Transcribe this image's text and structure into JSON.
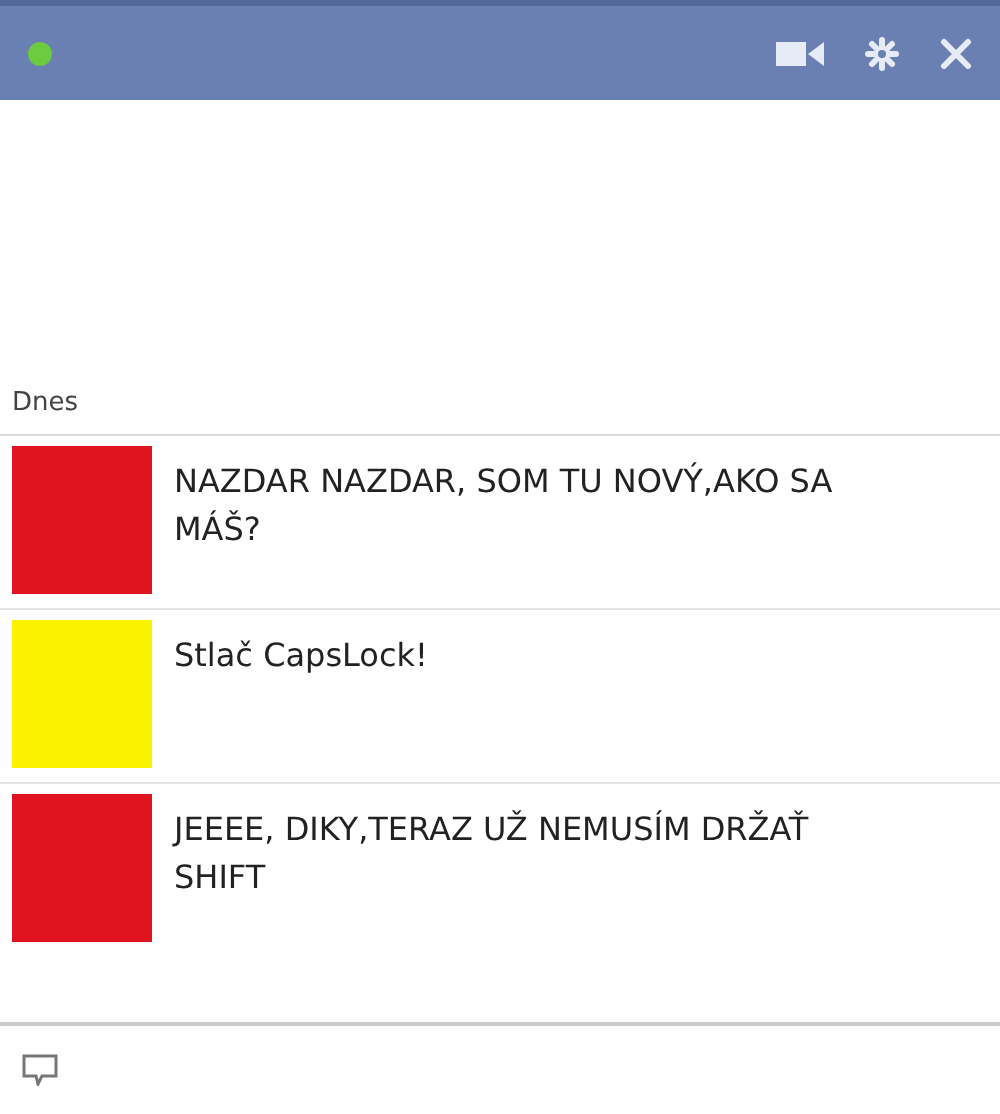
{
  "header": {
    "online": true
  },
  "date_label": "Dnes",
  "messages": [
    {
      "text": "NAZDAR NAZDAR, SOM TU NOVÝ,AKO SA MÁŠ?",
      "color": "#e0141e"
    },
    {
      "text": "Stlač CapsLock!",
      "color": "#fbf200"
    },
    {
      "text": "JEEEE, DIKY,TERAZ UŽ NEMUSÍM DRŽAŤ SHIFT",
      "color": "#e0141e"
    }
  ]
}
